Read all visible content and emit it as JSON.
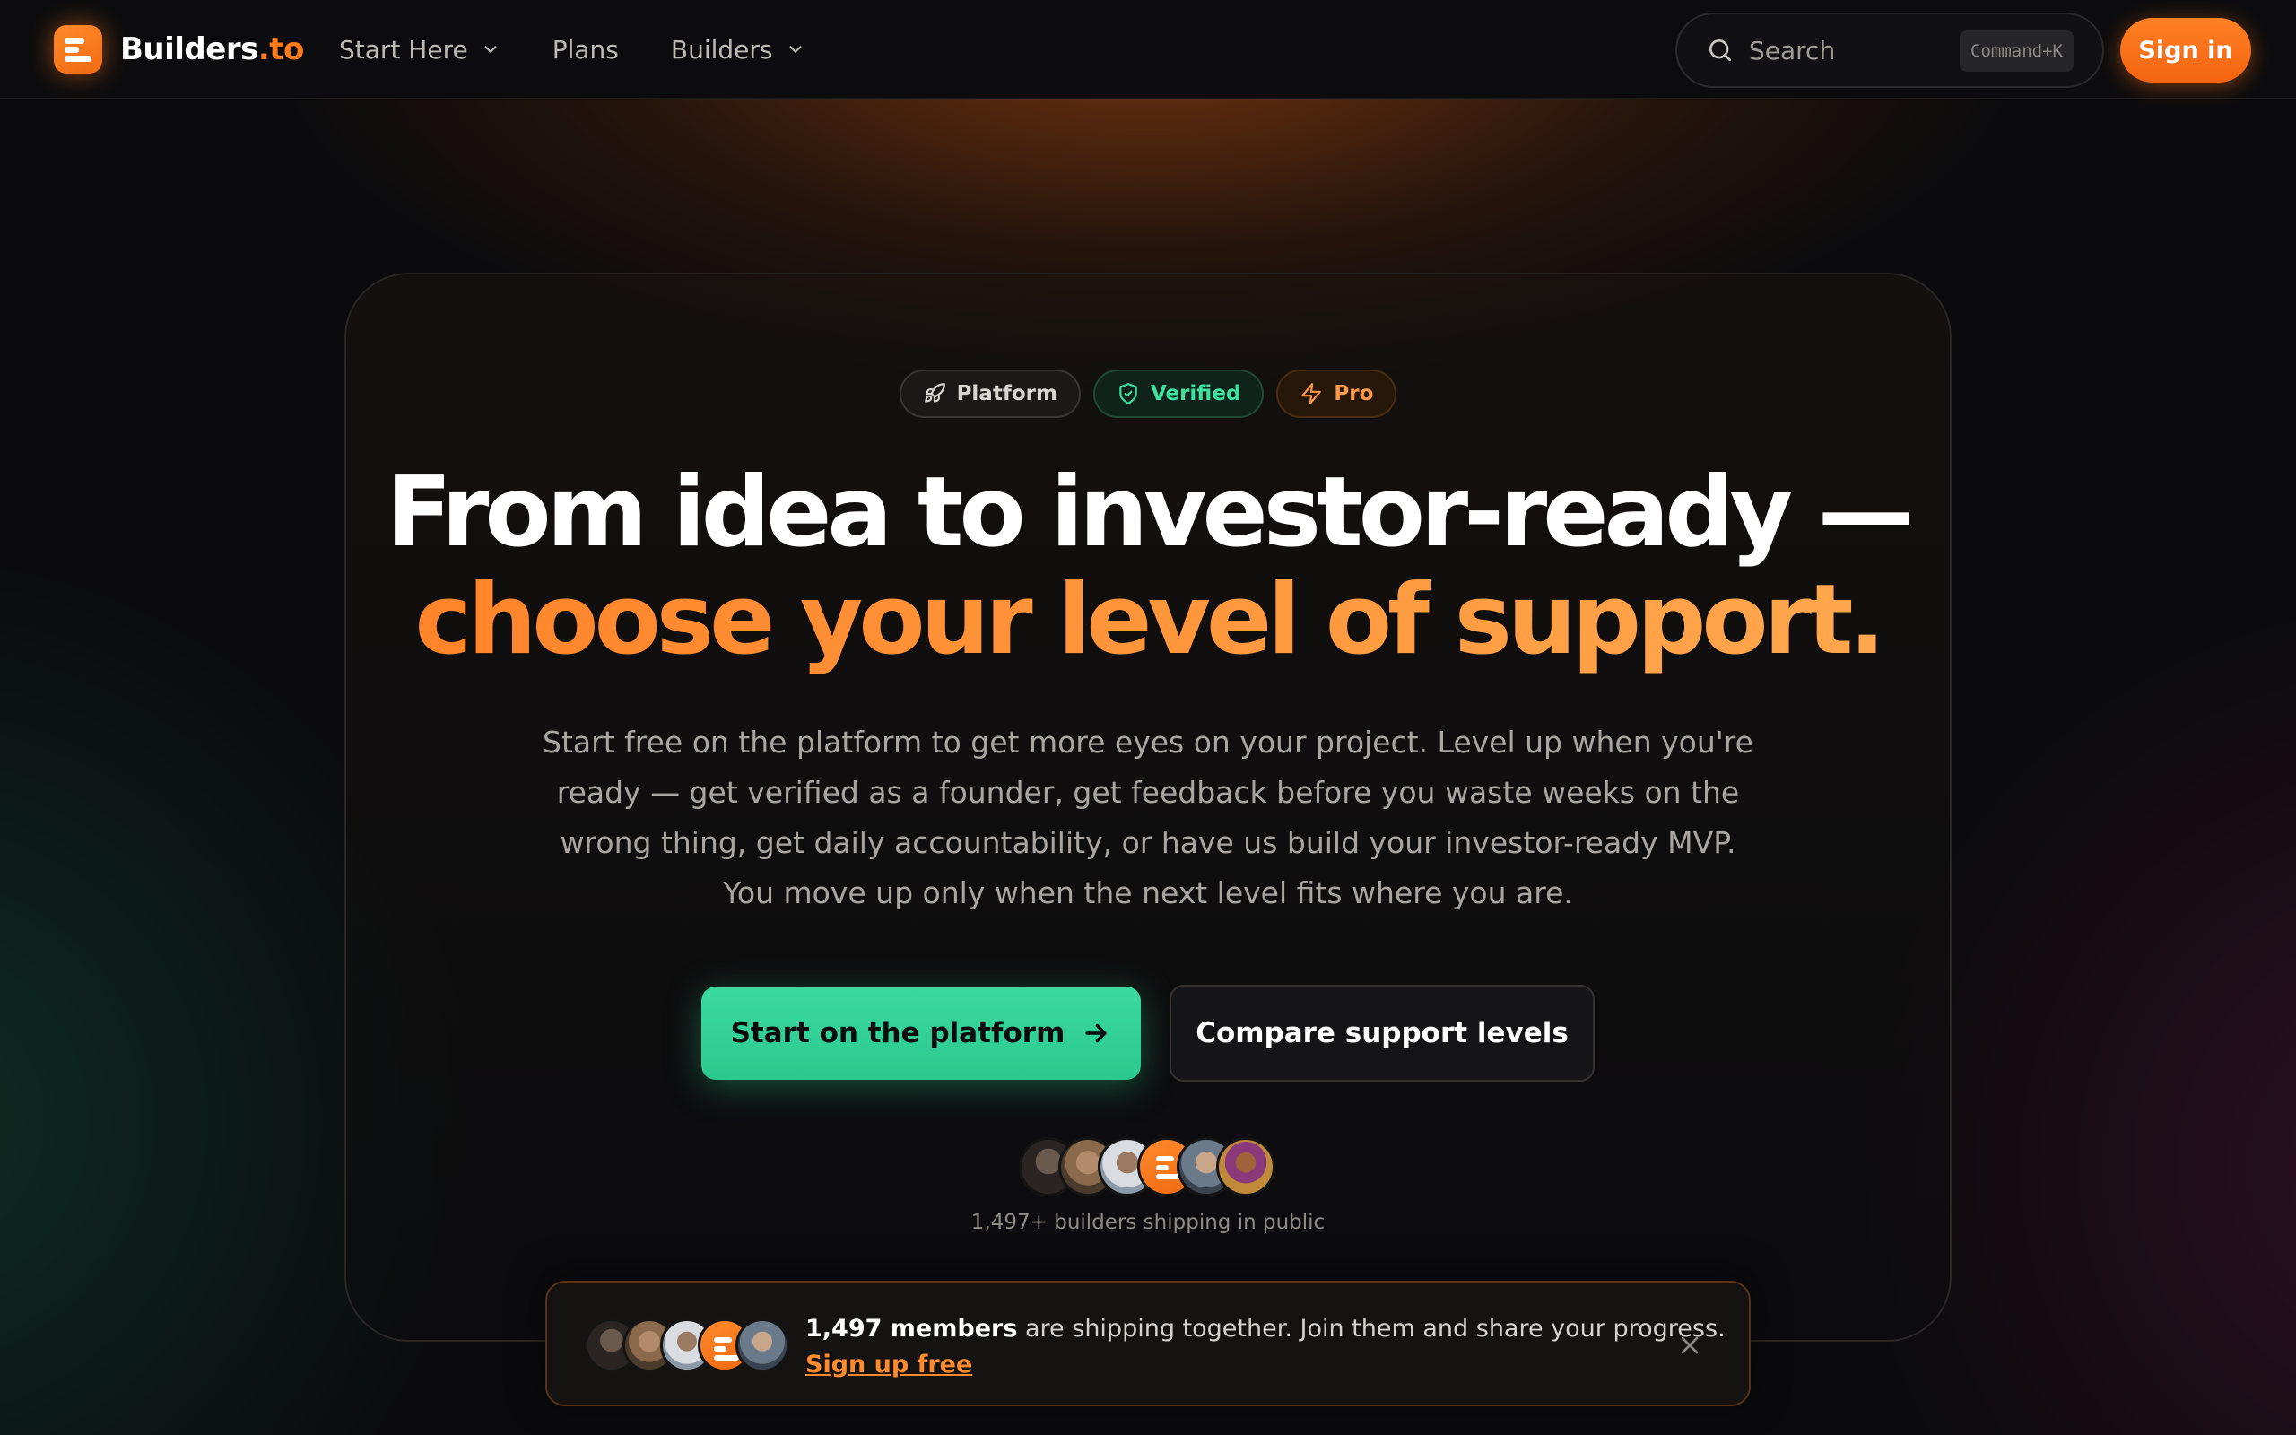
{
  "nav": {
    "brand": {
      "name": "Builders",
      "tld": ".to"
    },
    "links": [
      {
        "label": "Start Here",
        "has_dropdown": true
      },
      {
        "label": "Plans",
        "has_dropdown": false
      },
      {
        "label": "Builders",
        "has_dropdown": true
      }
    ],
    "search": {
      "placeholder": "Search",
      "shortcut": "Command+K"
    },
    "signin_label": "Sign in"
  },
  "hero": {
    "badges": [
      {
        "label": "Platform",
        "icon": "rocket-icon"
      },
      {
        "label": "Verified",
        "icon": "shield-check-icon"
      },
      {
        "label": "Pro",
        "icon": "lightning-icon"
      }
    ],
    "headline_line1": "From idea to investor-ready —",
    "headline_line2": "choose your level of support.",
    "lead": "Start free on the platform to get more eyes on your project. Level up when you're ready — get verified as a founder, get feedback before you waste weeks on the wrong thing, get daily accountability, or have us build your investor-ready MVP. You move up only when the next level fits where you are.",
    "cta_primary": "Start on the platform",
    "cta_secondary": "Compare support levels",
    "social_proof": "1,497+ builders shipping in public"
  },
  "banner": {
    "count_text": "1,497 members",
    "message": " are shipping together. Join them and share your progress.",
    "link_label": "Sign up free"
  },
  "colors": {
    "accent": "#ff7a1a",
    "primary_cta": "#2fd397",
    "background": "#0b0b0d"
  }
}
